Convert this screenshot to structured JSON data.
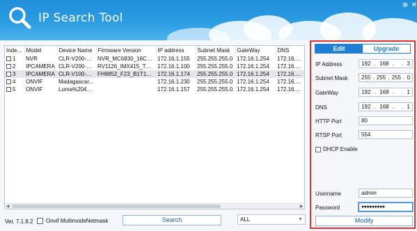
{
  "app": {
    "title": "IP Search Tool",
    "version": "Ver. 7.1.8.2"
  },
  "window_controls": {
    "settings_icon": "plus-circle-icon",
    "close_icon": "close-icon"
  },
  "table": {
    "columns": [
      "Inde...",
      "Model",
      "Device Name",
      "Firmware Version",
      "IP address",
      "Subnet Mask",
      "GateWay",
      "DNS"
    ],
    "rows": [
      {
        "index": "1",
        "model": "NVR",
        "device_name": "CLR-V200-8P...",
        "firmware": "NVR_MC6830_16CH_8...",
        "ip": "172.16.1.155",
        "mask": "255.255.255.0",
        "gateway": "172.16.1.254",
        "dns": "172.16.1.254",
        "checked": false,
        "selected": false
      },
      {
        "index": "2",
        "model": "IPCAMERA",
        "device_name": "CLR-V200-8T...",
        "firmware": "RV1126_IMX415_TKH...",
        "ip": "172.16.1.100",
        "mask": "255.255.255.0",
        "gateway": "172.16.1.254",
        "dns": "172.16.1.254",
        "checked": false,
        "selected": false
      },
      {
        "index": "3",
        "model": "IPCAMERA",
        "device_name": "CLR-V100-2T...",
        "firmware": "FH8852_F23_B1T1A1M...",
        "ip": "172.16.1.174",
        "mask": "255.255.255.0",
        "gateway": "172.16.1.254",
        "dns": "172.16.1.254",
        "checked": false,
        "selected": true
      },
      {
        "index": "4",
        "model": "ONVIF",
        "device_name": "Madagascar...",
        "firmware": "",
        "ip": "172.16.1.230",
        "mask": "255.255.255.0",
        "gateway": "172.16.1.254",
        "dns": "172.16.1.254",
        "checked": false,
        "selected": false
      },
      {
        "index": "5",
        "model": "ONVIF",
        "device_name": "Luma%204C...",
        "firmware": "",
        "ip": "172.16.1.157",
        "mask": "255.255.255.0",
        "gateway": "172.16.1.254",
        "dns": "172.16.1.254",
        "checked": false,
        "selected": false
      }
    ]
  },
  "bottom": {
    "onvif_mask_label": "Onvif MultimodeNetmask",
    "search_label": "Search",
    "filter_value": "ALL"
  },
  "panel": {
    "tabs": {
      "edit": "Edit",
      "upgrade": "Upgrade"
    },
    "labels": {
      "ip": "IP Address",
      "mask": "Subnet Mask",
      "gateway": "GateWay",
      "dns": "DNS",
      "http_port": "HTTP Port",
      "rtsp_port": "RTSP Port",
      "dhcp": "DHCP Enable",
      "username": "Username",
      "password": "Password"
    },
    "values": {
      "ip": [
        "192",
        "168",
        "3"
      ],
      "mask": [
        "255",
        "255",
        "255",
        "0"
      ],
      "gateway": [
        "192",
        "168",
        "1"
      ],
      "dns": [
        "192",
        "168",
        "1"
      ],
      "http_port": "80",
      "rtsp_port": "554",
      "username": "admin",
      "password": "●●●●●●●●●"
    },
    "modify_label": "Modify"
  },
  "colors": {
    "header": "#2b9de3",
    "accent": "#1f7fd6",
    "highlight_border": "#e03030"
  }
}
